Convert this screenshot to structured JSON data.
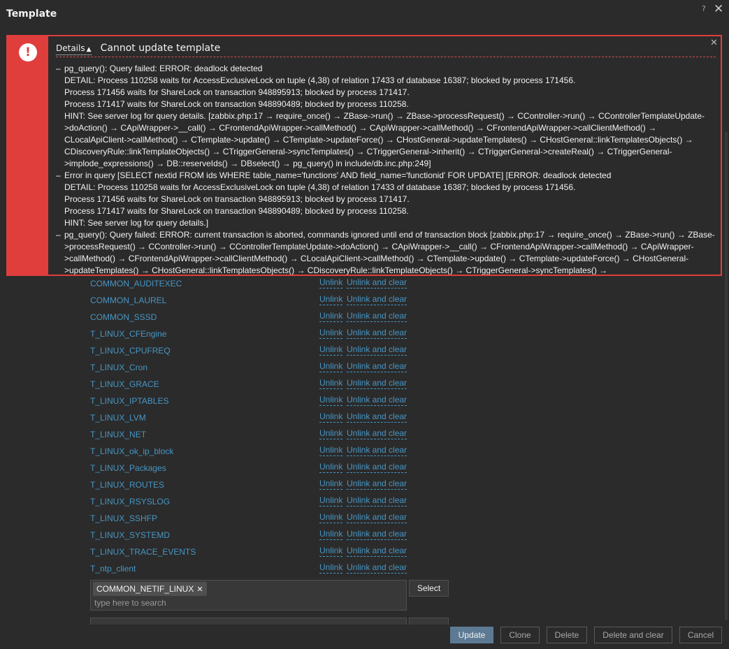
{
  "dialog": {
    "title": "Template",
    "help_label": "?",
    "close_label": "✕"
  },
  "error": {
    "icon": "!",
    "details_label": "Details",
    "details_arrow": "▲",
    "title": "Cannot update template",
    "close_label": "✕",
    "dash": "–",
    "messages": [
      [
        "pg_query(): Query failed: ERROR: deadlock detected",
        "DETAIL: Process 110258 waits for AccessExclusiveLock on tuple (4,38) of relation 17433 of database 16387; blocked by process 171456.",
        "Process 171456 waits for ShareLock on transaction 948895913; blocked by process 171417.",
        "Process 171417 waits for ShareLock on transaction 948890489; blocked by process 110258.",
        "HINT: See server log for query details. [zabbix.php:17 → require_once() → ZBase->run() → ZBase->processRequest() → CController->run() → CControllerTemplateUpdate->doAction() → CApiWrapper->__call() → CFrontendApiWrapper->callMethod() → CApiWrapper->callMethod() → CFrontendApiWrapper->callClientMethod() → CLocalApiClient->callMethod() → CTemplate->update() → CTemplate->updateForce() → CHostGeneral->updateTemplates() → CHostGeneral::linkTemplatesObjects() → CDiscoveryRule::linkTemplateObjects() → CTriggerGeneral->syncTemplates() → CTriggerGeneral->inherit() → CTriggerGeneral->createReal() → CTriggerGeneral->implode_expressions() → DB::reserveIds() → DBselect() → pg_query() in include/db.inc.php:249]"
      ],
      [
        "Error in query [SELECT nextid FROM ids WHERE table_name='functions' AND field_name='functionid' FOR UPDATE] [ERROR: deadlock detected",
        "DETAIL: Process 110258 waits for AccessExclusiveLock on tuple (4,38) of relation 17433 of database 16387; blocked by process 171456.",
        "Process 171456 waits for ShareLock on transaction 948895913; blocked by process 171417.",
        "Process 171417 waits for ShareLock on transaction 948890489; blocked by process 110258.",
        "HINT: See server log for query details.]"
      ],
      [
        "pg_query(): Query failed: ERROR: current transaction is aborted, commands ignored until end of transaction block [zabbix.php:17 → require_once() → ZBase->run() → ZBase->processRequest() → CController->run() → CControllerTemplateUpdate->doAction() → CApiWrapper->__call() → CFrontendApiWrapper->callMethod() → CApiWrapper->callMethod() → CFrontendApiWrapper->callClientMethod() → CLocalApiClient->callMethod() → CTemplate->update() → CTemplate->updateForce() → CHostGeneral->updateTemplates() → CHostGeneral::linkTemplatesObjects() → CDiscoveryRule::linkTemplateObjects() → CTriggerGeneral->syncTemplates() →"
      ]
    ]
  },
  "linked_templates": {
    "unlink_label": "Unlink",
    "unlink_clear_label": "Unlink and clear",
    "items": [
      "COMMON_AUDITEXEC",
      "COMMON_LAUREL",
      "COMMON_SSSD",
      "T_LINUX_CFEngine",
      "T_LINUX_CPUFREQ",
      "T_LINUX_Cron",
      "T_LINUX_GRACE",
      "T_LINUX_IPTABLES",
      "T_LINUX_LVM",
      "T_LINUX_NET",
      "T_LINUX_ok_ip_block",
      "T_LINUX_Packages",
      "T_LINUX_ROUTES",
      "T_LINUX_RSYSLOG",
      "T_LINUX_SSHFP",
      "T_LINUX_SYSTEMD",
      "T_LINUX_TRACE_EVENTS",
      "T_ntp_client"
    ]
  },
  "link_new": {
    "chip_label": "COMMON_NETIF_LINUX",
    "chip_remove": "✕",
    "search_placeholder": "type here to search",
    "select_label": "Select"
  },
  "footer": {
    "update_label": "Update",
    "clone_label": "Clone",
    "delete_label": "Delete",
    "delete_clear_label": "Delete and clear",
    "cancel_label": "Cancel"
  },
  "colors": {
    "background": "#2b2b2b",
    "error_red": "#e03d3d",
    "link_blue": "#4796c4",
    "primary_button": "#5d7a94"
  }
}
